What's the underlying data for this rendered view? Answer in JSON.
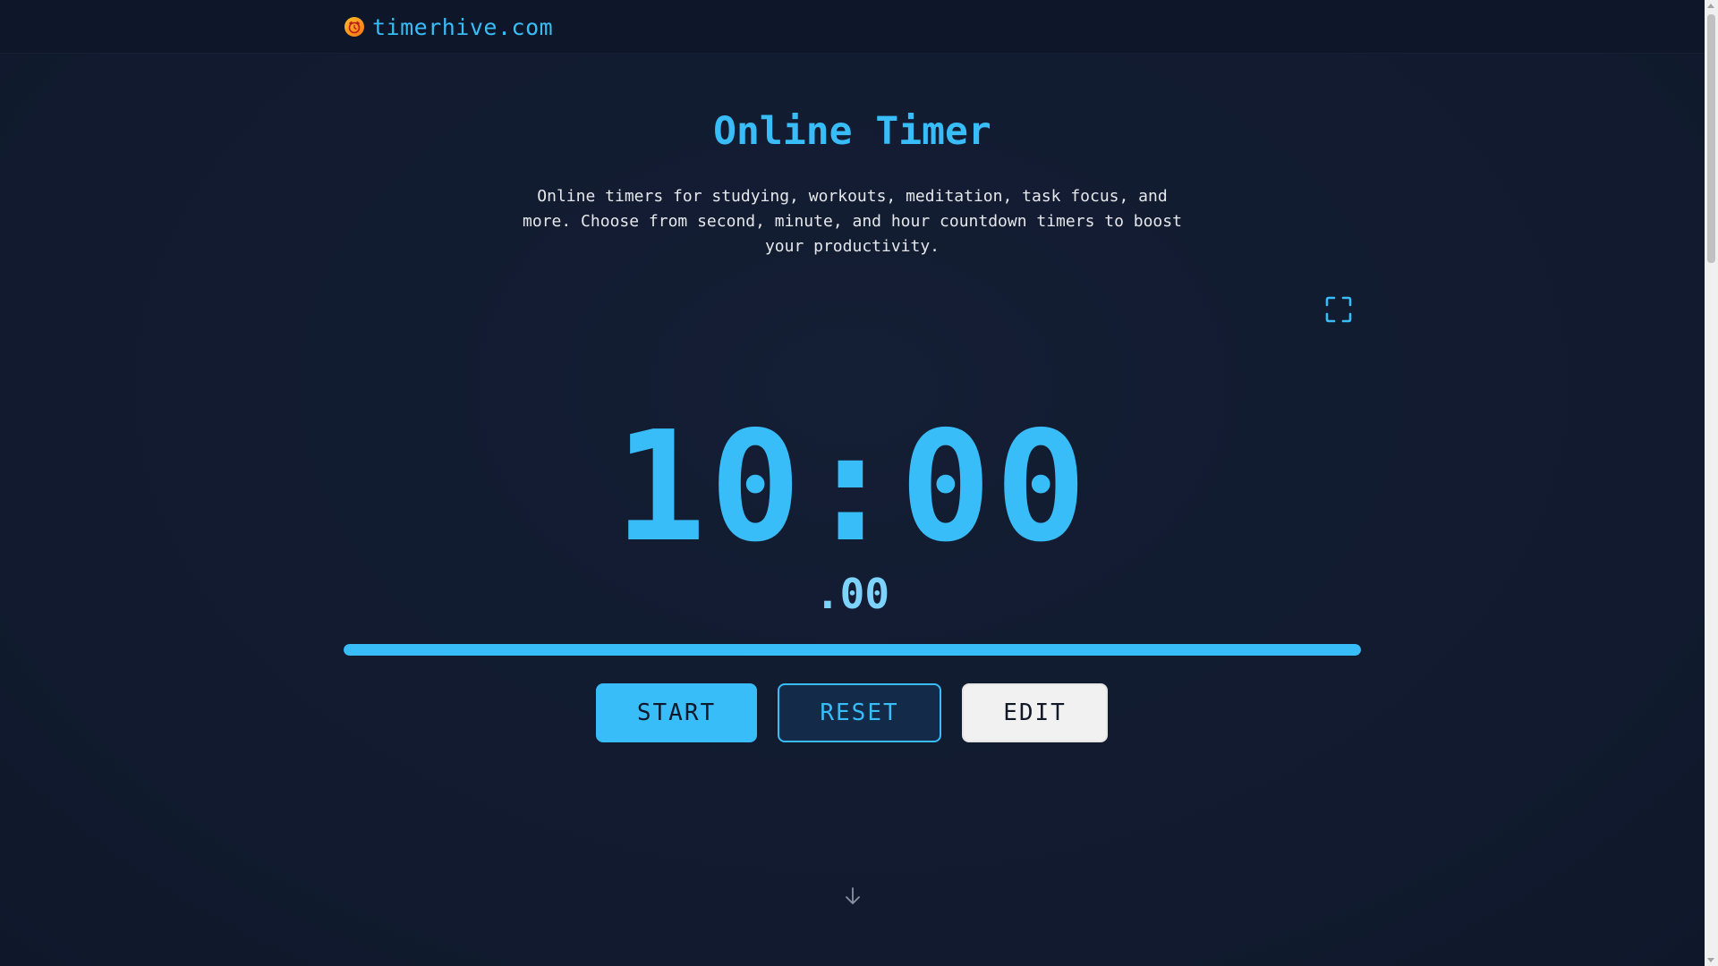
{
  "header": {
    "site_name": "timerhive.com",
    "logo_icon": "alarm-clock-icon"
  },
  "main": {
    "title": "Online Timer",
    "description": "Online timers for studying, workouts, meditation, task focus, and more. Choose from second, minute, and hour countdown timers to boost your productivity.",
    "fullscreen_icon": "fullscreen-icon",
    "timer": {
      "display": "10:00",
      "milliseconds": ".00",
      "progress_percent": 100
    },
    "buttons": {
      "start": "START",
      "reset": "RESET",
      "edit": "EDIT"
    },
    "scroll_hint_icon": "arrow-down-icon"
  },
  "colors": {
    "accent": "#38bdf8",
    "background": "#111a2e",
    "header_bg": "#0e172a",
    "edit_button_bg": "#f1f1f1"
  }
}
